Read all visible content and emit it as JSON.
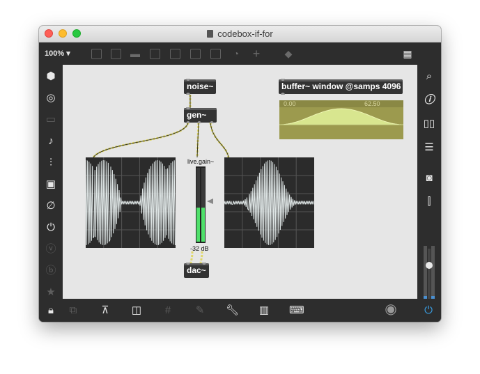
{
  "window": {
    "title": "codebox-if-for"
  },
  "toolbar": {
    "zoom": "100%",
    "icons": [
      "presentation-mode-icon",
      "message-box-icon",
      "comment-icon",
      "toggle-icon",
      "button-icon",
      "play-icon",
      "slider-icon",
      "dial-icon",
      "add-object-icon",
      "paint-bucket-icon",
      "grid-icon"
    ]
  },
  "left_sidebar": {
    "icons": [
      "cube-icon",
      "target-icon",
      "keyboard-panel-icon",
      "music-note-icon",
      "sequencer-icon",
      "image-icon",
      "paperclip-icon",
      "plug-icon",
      "v-circle-icon",
      "b-circle-icon",
      "star-icon"
    ]
  },
  "right_sidebar": {
    "icons": [
      "search-icon",
      "info-icon",
      "book-icon",
      "list-icon",
      "camera-icon",
      "mixer-icon"
    ]
  },
  "patch": {
    "noise_label": "noise~",
    "gen_label": "gen~",
    "dac_label": "dac~",
    "buffer_label": "buffer~ window @samps 4096",
    "buffer_min": "0.00",
    "buffer_max": "62.50",
    "gain_title": "live.gain~",
    "gain_value": "-32 dB",
    "gain_level": 0.46
  },
  "bottom": {
    "icons": [
      "lock-icon",
      "edit-icon",
      "presentation-icon",
      "windows-icon",
      "grid-icon",
      "debug-icon",
      "wrench-icon",
      "piano-icon",
      "keyboard-icon",
      "transport-icon",
      "power-icon"
    ]
  },
  "colors": {
    "accent_green": "#4fe06a",
    "buffer_bg": "#9c9a4e",
    "buffer_fill": "#d8e68f",
    "power_blue": "#3aa0e6"
  }
}
